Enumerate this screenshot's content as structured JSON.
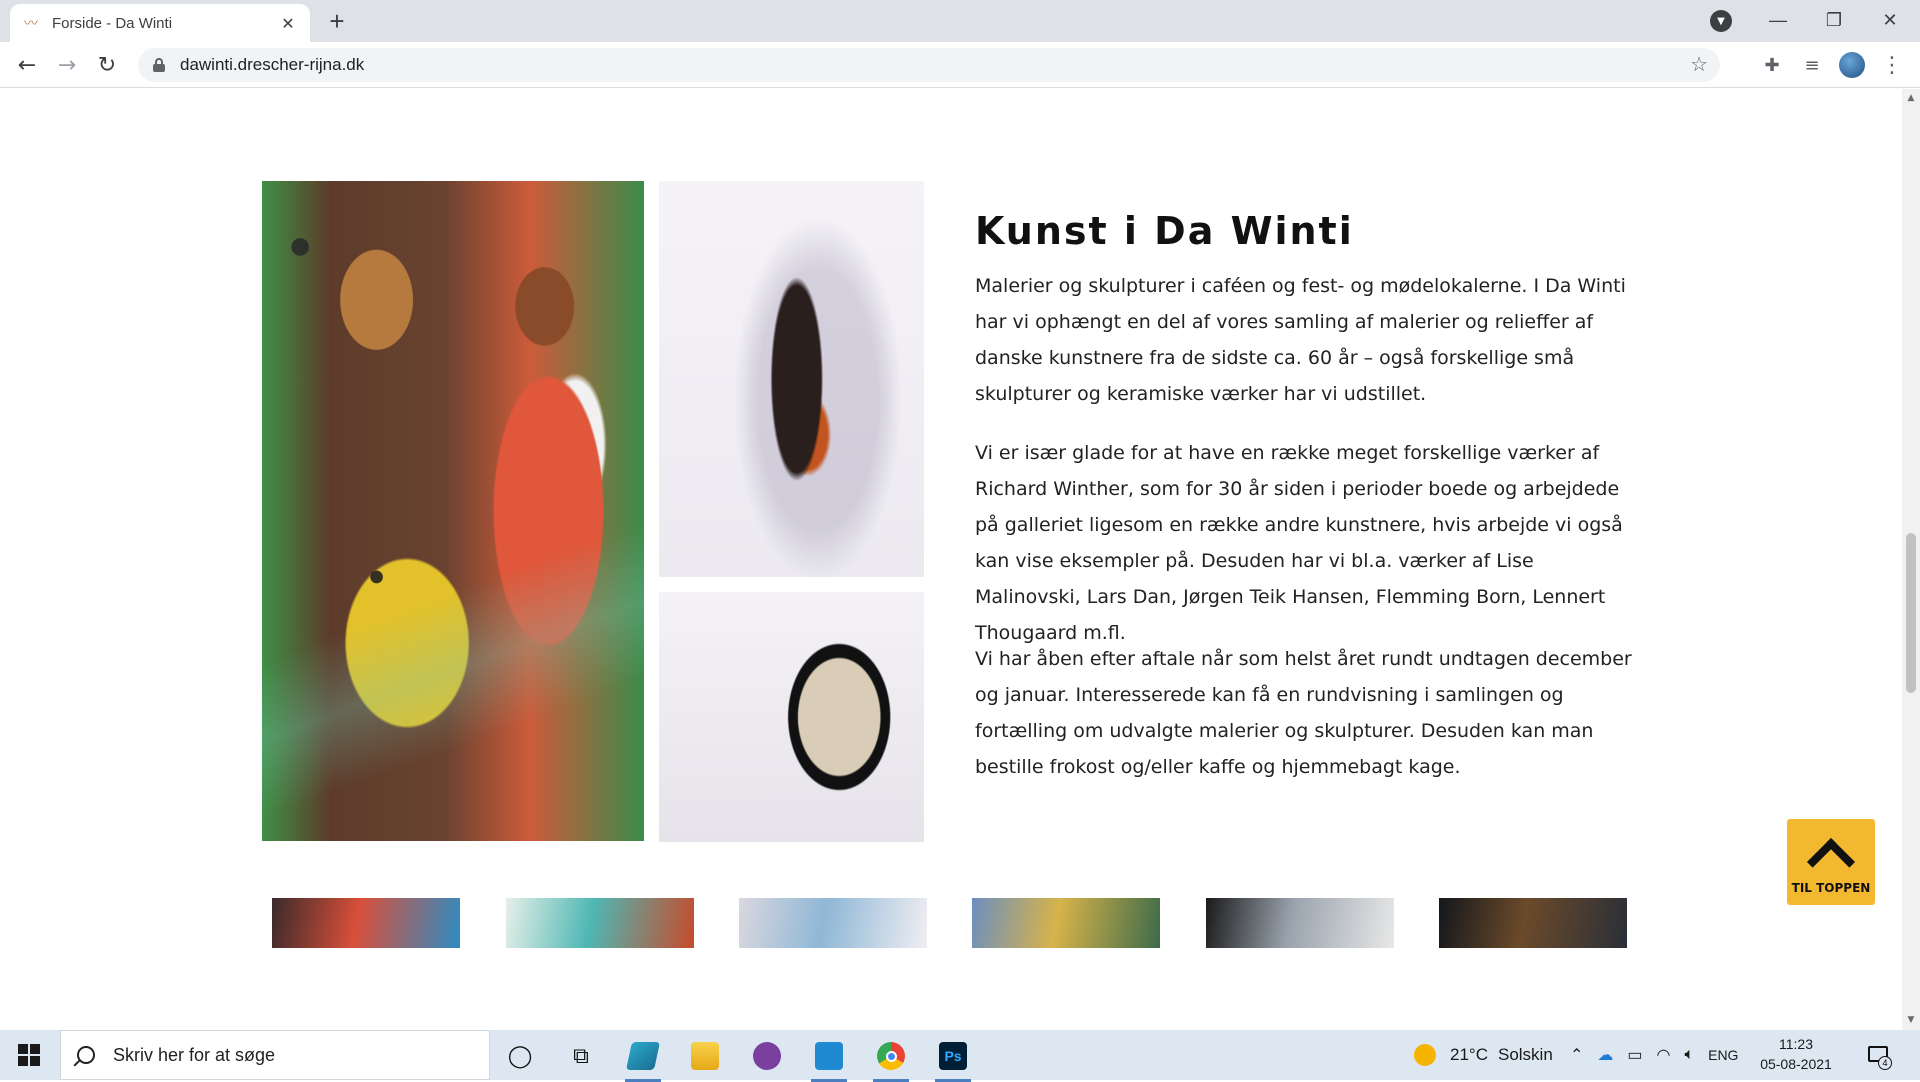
{
  "browser": {
    "tab": {
      "title": "Forside - Da Winti",
      "close_glyph": "✕"
    },
    "new_tab_glyph": "+",
    "window_controls": {
      "minimize": "—",
      "restore": "❐",
      "close": "✕"
    },
    "nav": {
      "back": "←",
      "forward": "→",
      "reload": "↻"
    },
    "url": "dawinti.drescher-rijna.dk",
    "bookmark_glyph": "☆",
    "extensions_glyph": "✚",
    "media_glyph": "≡",
    "menu_glyph": "⋮"
  },
  "section": {
    "heading": "Kunst i Da Winti",
    "paragraphs": [
      "Malerier og skulpturer i caféen og fest- og mødelokalerne. I Da Winti har vi ophængt en del af vores samling af malerier og relieffer af danske kunstnere fra de sidste ca. 60 år – også forskellige små skulpturer og keramiske værker har vi udstillet.",
      "Vi er især glade for at have en række meget forskellige værker af Richard Winther, som for 30 år siden i perioder boede og arbejdede på galleriet ligesom en række andre kunstnere, hvis arbejde vi også kan vise eksempler på. Desuden har vi bl.a. værker af Lise Malinovski, Lars Dan, Jørgen Teik Hansen, Flemming Born, Lennert Thougaard m.fl.",
      "Vi har åben efter aftale når som helst året rundt undtagen december og januar. Interesserede kan få en rundvisning i samlingen og fortælling om udvalgte malerier og skulpturer. Desuden kan man bestille frokost og/eller kaffe og hjemmebagt kage."
    ]
  },
  "to_top": {
    "label": "TIL TOPPEN"
  },
  "thumbnails": [
    {
      "colors": [
        "#3a2a2a",
        "#d84f3a",
        "#2e8cc2"
      ]
    },
    {
      "colors": [
        "#e7efe8",
        "#4fb7b4",
        "#c64b2a"
      ]
    },
    {
      "colors": [
        "#dad7df",
        "#8fb7d6",
        "#f0eef2"
      ]
    },
    {
      "colors": [
        "#6c8fbf",
        "#d7b34a",
        "#3d6b4a"
      ]
    },
    {
      "colors": [
        "#1a1a1a",
        "#9aa3ad",
        "#e8e8e8"
      ]
    },
    {
      "colors": [
        "#14171c",
        "#6b4a2a",
        "#2a2f38"
      ]
    }
  ],
  "taskbar": {
    "search_placeholder": "Skriv her for at søge",
    "apps": [
      {
        "name": "cortana",
        "glyph": "◯"
      },
      {
        "name": "task-view",
        "glyph": "⧉"
      },
      {
        "name": "edge-like",
        "glyph": ""
      },
      {
        "name": "file-explorer",
        "glyph": ""
      },
      {
        "name": "github-desktop",
        "glyph": ""
      },
      {
        "name": "vs-code",
        "glyph": ""
      },
      {
        "name": "chrome",
        "glyph": ""
      },
      {
        "name": "photoshop",
        "glyph": "Ps"
      }
    ],
    "weather": {
      "temp": "21°C",
      "label": "Solskin"
    },
    "language": "ENG",
    "time": "11:23",
    "date": "05-08-2021",
    "notification_count": "4"
  },
  "colors": {
    "accent": "#f2b830",
    "text": "#222222",
    "taskbar": "#dde7f2"
  }
}
